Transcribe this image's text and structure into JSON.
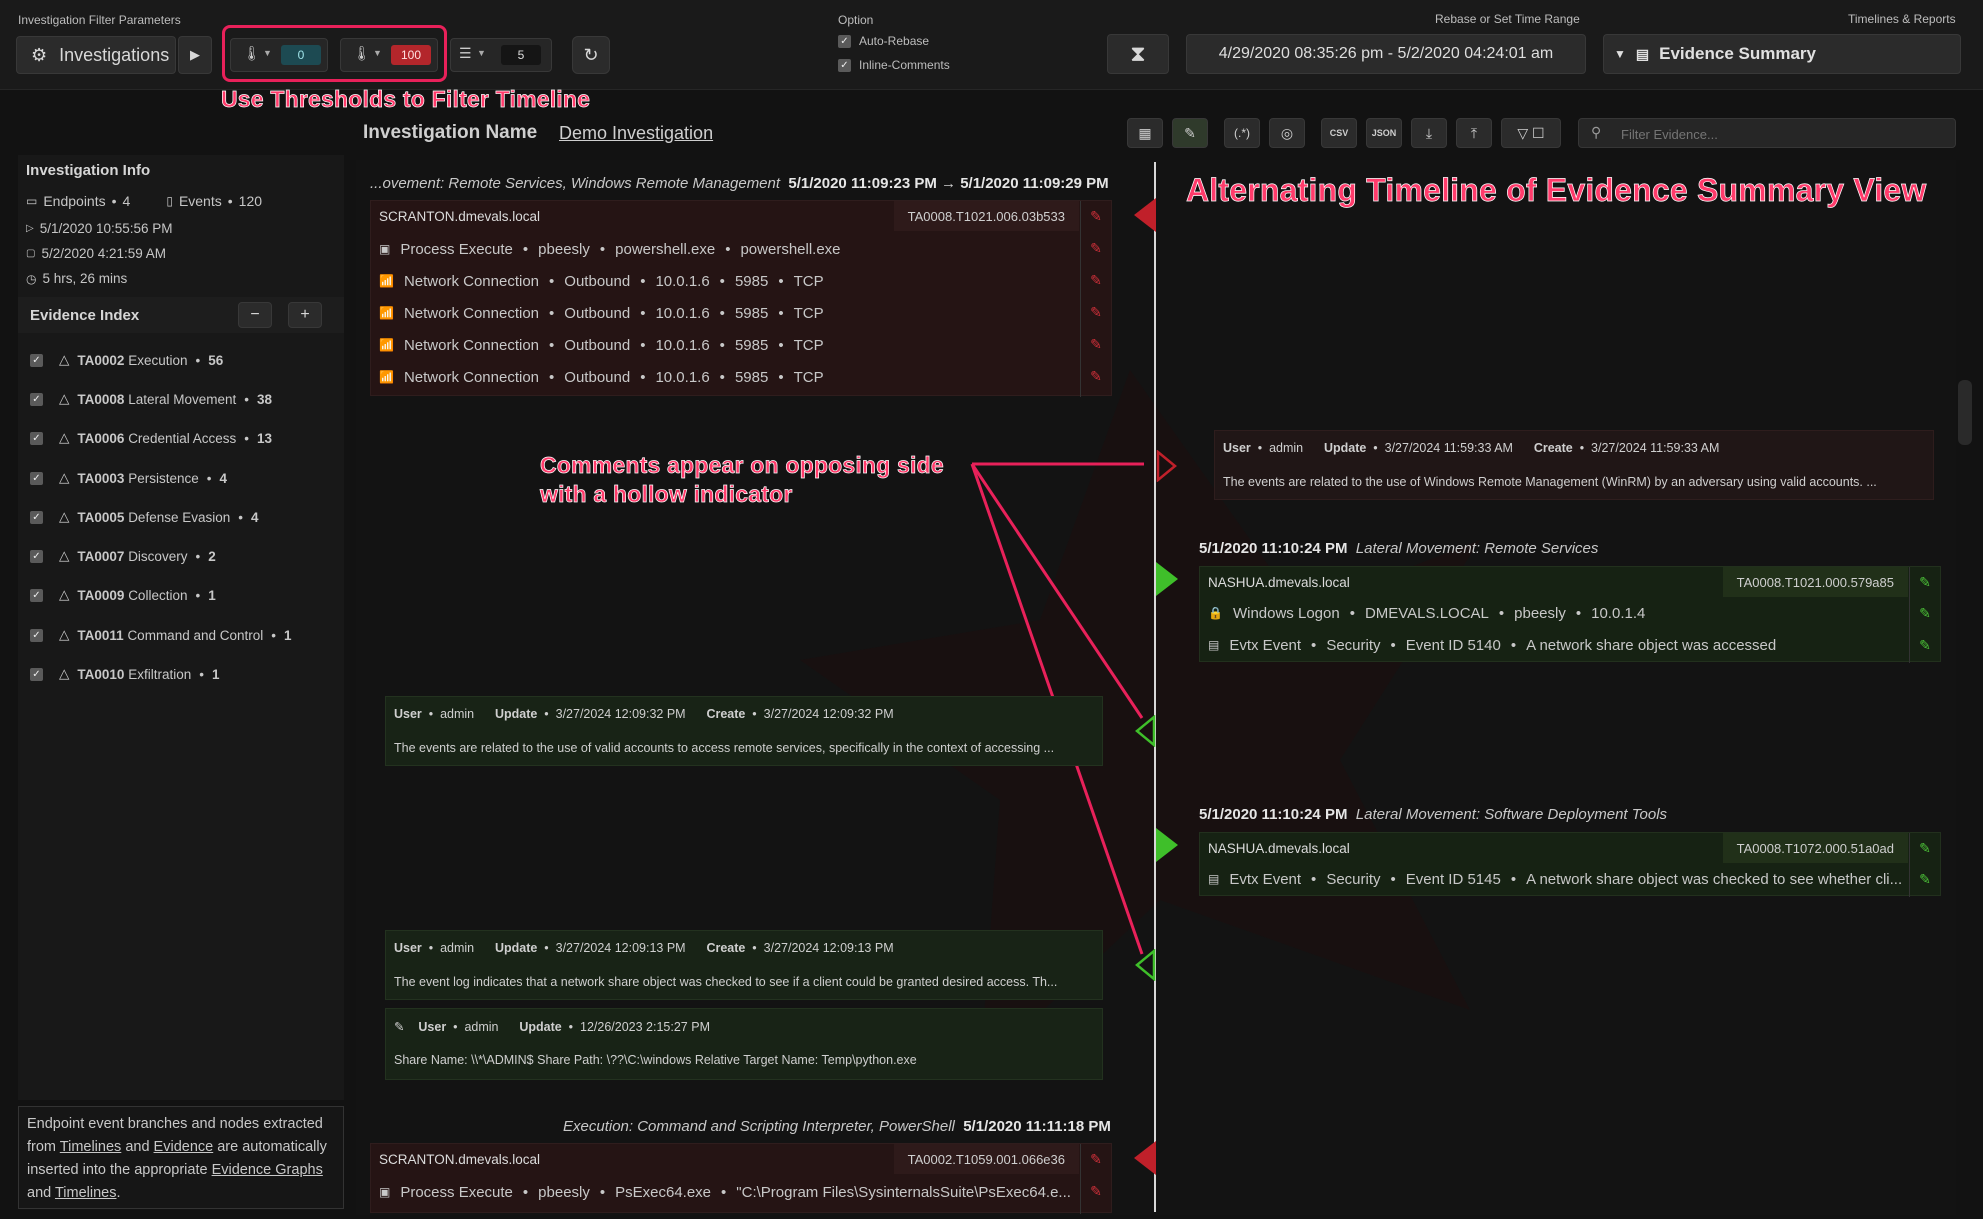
{
  "header": {
    "filter_params_label": "Investigation Filter Parameters",
    "investigations_label": "Investigations",
    "threshold_low": "0",
    "threshold_high": "100",
    "count_value": "5",
    "option_label": "Option",
    "auto_rebase_label": "Auto-Rebase",
    "inline_comments_label": "Inline-Comments",
    "rebase_label": "Rebase or Set Time Range",
    "time_range": "4/29/2020 08:35:26 pm - 5/2/2020 04:24:01 am",
    "timelines_reports_label": "Timelines & Reports",
    "evidence_summary_label": "Evidence Summary"
  },
  "annotations": {
    "thresholds": "Use Thresholds to Filter Timeline",
    "alternating": "Alternating Timeline of Evidence Summary View",
    "comments_line1": "Comments appear on opposing side",
    "comments_line2": "with a hollow indicator"
  },
  "toolbar": {
    "investigation_name_label": "Investigation Name",
    "investigation_name": "Demo Investigation",
    "filter_placeholder": "Filter Evidence...",
    "icons": [
      "calculator-icon",
      "pencil-icon",
      "regex-icon",
      "fingerprint-icon",
      "csv-icon",
      "json-icon",
      "download-icon",
      "upload-icon",
      "filter-toggle-icon"
    ],
    "csv_text": "CSV",
    "json_text": "JSON"
  },
  "sidebar": {
    "info_title": "Investigation Info",
    "endpoints_label": "Endpoints",
    "endpoints_count": "4",
    "events_label": "Events",
    "events_count": "120",
    "start_time": "5/1/2020 10:55:56 PM",
    "end_time": "5/2/2020 4:21:59 AM",
    "duration": "5 hrs, 26 mins",
    "evidence_index_title": "Evidence Index",
    "items": [
      {
        "code": "TA0002",
        "name": "Execution",
        "count": "56"
      },
      {
        "code": "TA0008",
        "name": "Lateral Movement",
        "count": "38"
      },
      {
        "code": "TA0006",
        "name": "Credential Access",
        "count": "13"
      },
      {
        "code": "TA0003",
        "name": "Persistence",
        "count": "4"
      },
      {
        "code": "TA0005",
        "name": "Defense Evasion",
        "count": "4"
      },
      {
        "code": "TA0007",
        "name": "Discovery",
        "count": "2"
      },
      {
        "code": "TA0009",
        "name": "Collection",
        "count": "1"
      },
      {
        "code": "TA0011",
        "name": "Command and Control",
        "count": "1"
      },
      {
        "code": "TA0010",
        "name": "Exfiltration",
        "count": "1"
      }
    ],
    "footer_text_1": "Endpoint event branches and nodes extracted from ",
    "footer_link_1": "Timelines",
    "footer_text_2": " and ",
    "footer_link_2": "Evidence",
    "footer_text_3": " are automatically inserted into the appropriate ",
    "footer_link_3": "Evidence Graphs",
    "footer_text_4": " and ",
    "footer_link_4": "Timelines",
    "footer_text_5": "."
  },
  "timeline": {
    "e1": {
      "title": "...ovement: Remote Services, Windows Remote Management",
      "time_start": "5/1/2020 11:09:23 PM",
      "arrow": "→",
      "time_end": "5/1/2020 11:09:29 PM",
      "host": "SCRANTON.dmevals.local",
      "tag": "TA0008.T1021.006.03b533",
      "lines": [
        [
          "Process Execute",
          "pbeesly",
          "powershell.exe",
          "powershell.exe"
        ],
        [
          "Network Connection",
          "Outbound",
          "10.0.1.6",
          "5985",
          "TCP"
        ],
        [
          "Network Connection",
          "Outbound",
          "10.0.1.6",
          "5985",
          "TCP"
        ],
        [
          "Network Connection",
          "Outbound",
          "10.0.1.6",
          "5985",
          "TCP"
        ],
        [
          "Network Connection",
          "Outbound",
          "10.0.1.6",
          "5985",
          "TCP"
        ]
      ]
    },
    "c1": {
      "user_label": "User",
      "user": "admin",
      "update_label": "Update",
      "update": "3/27/2024 11:59:33 AM",
      "create_label": "Create",
      "create": "3/27/2024 11:59:33 AM",
      "body": "The events are related to the use of Windows Remote Management (WinRM) by an adversary using valid accounts. ..."
    },
    "e2": {
      "time": "5/1/2020 11:10:24 PM",
      "title": "Lateral Movement: Remote Services",
      "host": "NASHUA.dmevals.local",
      "tag": "TA0008.T1021.000.579a85",
      "lines": [
        [
          "Windows Logon",
          "DMEVALS.LOCAL",
          "pbeesly",
          "10.0.1.4"
        ],
        [
          "Evtx Event",
          "Security",
          "Event ID 5140",
          "A network share object was accessed"
        ]
      ]
    },
    "c2": {
      "user_label": "User",
      "user": "admin",
      "update_label": "Update",
      "update": "3/27/2024 12:09:32 PM",
      "create_label": "Create",
      "create": "3/27/2024 12:09:32 PM",
      "body": "The events are related to the use of valid accounts to access remote services, specifically in the context of accessing ..."
    },
    "e3": {
      "time": "5/1/2020 11:10:24 PM",
      "title": "Lateral Movement: Software Deployment Tools",
      "host": "NASHUA.dmevals.local",
      "tag": "TA0008.T1072.000.51a0ad",
      "lines": [
        [
          "Evtx Event",
          "Security",
          "Event ID 5145",
          "A network share object was checked to see whether cli..."
        ]
      ]
    },
    "c3": {
      "user_label": "User",
      "user": "admin",
      "update_label": "Update",
      "update": "3/27/2024 12:09:13 PM",
      "create_label": "Create",
      "create": "3/27/2024 12:09:13 PM",
      "body": "The event log indicates that a network share object was checked to see if a client could be granted desired access. Th..."
    },
    "c4": {
      "user_label": "User",
      "user": "admin",
      "update_label": "Update",
      "update": "12/26/2023 2:15:27 PM",
      "body": "Share Name: \\\\*\\ADMIN$ Share Path: \\??\\C:\\windows Relative Target Name: Temp\\python.exe"
    },
    "e4": {
      "title": "Execution: Command and Scripting Interpreter, PowerShell",
      "time": "5/1/2020 11:11:18 PM",
      "host": "SCRANTON.dmevals.local",
      "tag": "TA0002.T1059.001.066e36",
      "lines": [
        [
          "Process Execute",
          "pbeesly",
          "PsExec64.exe",
          "\"C:\\Program Files\\SysinternalsSuite\\PsExec64.e..."
        ]
      ]
    }
  },
  "colors": {
    "accent_red": "#e8215a",
    "marker_red": "#c0202a",
    "marker_green": "#3fbf2a",
    "threshold_low_bg": "#1d4a52",
    "threshold_high_bg": "#b3262b"
  }
}
